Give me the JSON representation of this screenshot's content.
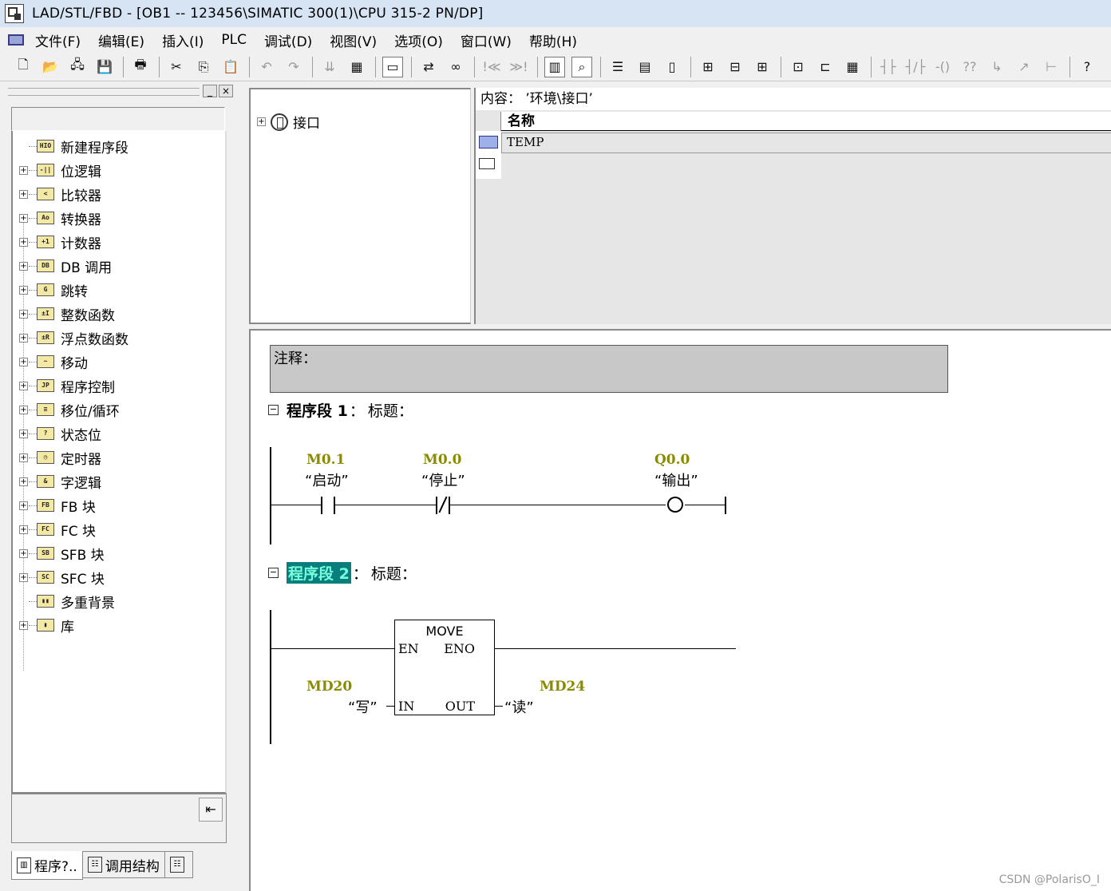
{
  "window": {
    "title": "LAD/STL/FBD  - [OB1 -- 123456\\SIMATIC 300(1)\\CPU 315-2 PN/DP]"
  },
  "menu": {
    "items": [
      "文件(F)",
      "编辑(E)",
      "插入(I)",
      "PLC",
      "调试(D)",
      "视图(V)",
      "选项(O)",
      "窗口(W)",
      "帮助(H)"
    ]
  },
  "toolbar": {
    "new": "🗋",
    "open": "📂",
    "network": "🖧",
    "save": "💾",
    "print": "🖶",
    "cut": "✂",
    "copy": "⎘",
    "paste": "📋",
    "undo": "↶",
    "redo": "↷",
    "download": "⇊",
    "monitor": "▦",
    "window": "▭",
    "accessible": "⇄",
    "glasses": "∞",
    "prev_error": "!≪",
    "next_error": "≫!",
    "overview": "▥",
    "zoom": "⌕",
    "catalog": "☰",
    "hsplit": "▤",
    "vsplit": "▯",
    "new_network": "⊞",
    "insert_contact": "⊟",
    "branch": "⊞",
    "box": "⊡",
    "box2": "⊏",
    "box3": "▦",
    "no_contact": "┤├",
    "nc_contact": "┤/├",
    "coil": "-()",
    "empty_box": "??",
    "open_branch": "↳",
    "close_branch": "↗",
    "connection": "⊢",
    "help": "?"
  },
  "left_panel": {
    "minimize": "_",
    "close": "×",
    "tree": [
      {
        "label": "新建程序段",
        "icon": "HIO",
        "expandable": false
      },
      {
        "label": "位逻辑",
        "icon": "-||",
        "expandable": true
      },
      {
        "label": "比较器",
        "icon": "<",
        "expandable": true
      },
      {
        "label": "转换器",
        "icon": "Ao",
        "expandable": true
      },
      {
        "label": "计数器",
        "icon": "+1",
        "expandable": true
      },
      {
        "label": "DB 调用",
        "icon": "DB",
        "expandable": true
      },
      {
        "label": "跳转",
        "icon": "G",
        "expandable": true
      },
      {
        "label": "整数函数",
        "icon": "±I",
        "expandable": true
      },
      {
        "label": "浮点数函数",
        "icon": "±R",
        "expandable": true
      },
      {
        "label": "移动",
        "icon": "~",
        "expandable": true
      },
      {
        "label": "程序控制",
        "icon": "JP",
        "expandable": true
      },
      {
        "label": "移位/循环",
        "icon": "≡",
        "expandable": true
      },
      {
        "label": "状态位",
        "icon": "?",
        "expandable": true
      },
      {
        "label": "定时器",
        "icon": "◷",
        "expandable": true
      },
      {
        "label": "字逻辑",
        "icon": "&",
        "expandable": true
      },
      {
        "label": "FB 块",
        "icon": "FB",
        "expandable": true
      },
      {
        "label": "FC 块",
        "icon": "FC",
        "expandable": true
      },
      {
        "label": "SFB 块",
        "icon": "SB",
        "expandable": true
      },
      {
        "label": "SFC 块",
        "icon": "SC",
        "expandable": true
      },
      {
        "label": "多重背景",
        "icon": "▮▮",
        "expandable": false
      },
      {
        "label": "库",
        "icon": "▮",
        "expandable": true
      }
    ],
    "bottom_button": "⇤",
    "tabs": [
      {
        "label": "程序?..",
        "icon": "▥"
      },
      {
        "label": "调用结构",
        "icon": "☷"
      },
      {
        "label": "",
        "icon": "☷"
      }
    ]
  },
  "interface": {
    "root_label": "接口"
  },
  "content": {
    "header": "内容：  ’环境\\接口’",
    "column_name": "名称",
    "rows": [
      "TEMP"
    ]
  },
  "editor": {
    "comment_label": "注释：",
    "networks": [
      {
        "title": "程序段  1",
        "sep": "：",
        "subtitle": "标题：",
        "contacts": [
          {
            "address": "M0.1",
            "symbol": "“启动”",
            "type": "NO"
          },
          {
            "address": "M0.0",
            "symbol": "“停止”",
            "type": "NC"
          }
        ],
        "coil": {
          "address": "Q0.0",
          "symbol": "“输出”"
        }
      },
      {
        "title": "程序段  2",
        "sep": "：",
        "subtitle": "标题：",
        "box": {
          "name": "MOVE",
          "en": "EN",
          "eno": "ENO",
          "in": "IN",
          "out": "OUT",
          "in_address": "MD20",
          "in_symbol": "“写”",
          "out_address": "MD24",
          "out_symbol": "“读”"
        }
      }
    ]
  },
  "watermark": "CSDN @PolarisO_I"
}
